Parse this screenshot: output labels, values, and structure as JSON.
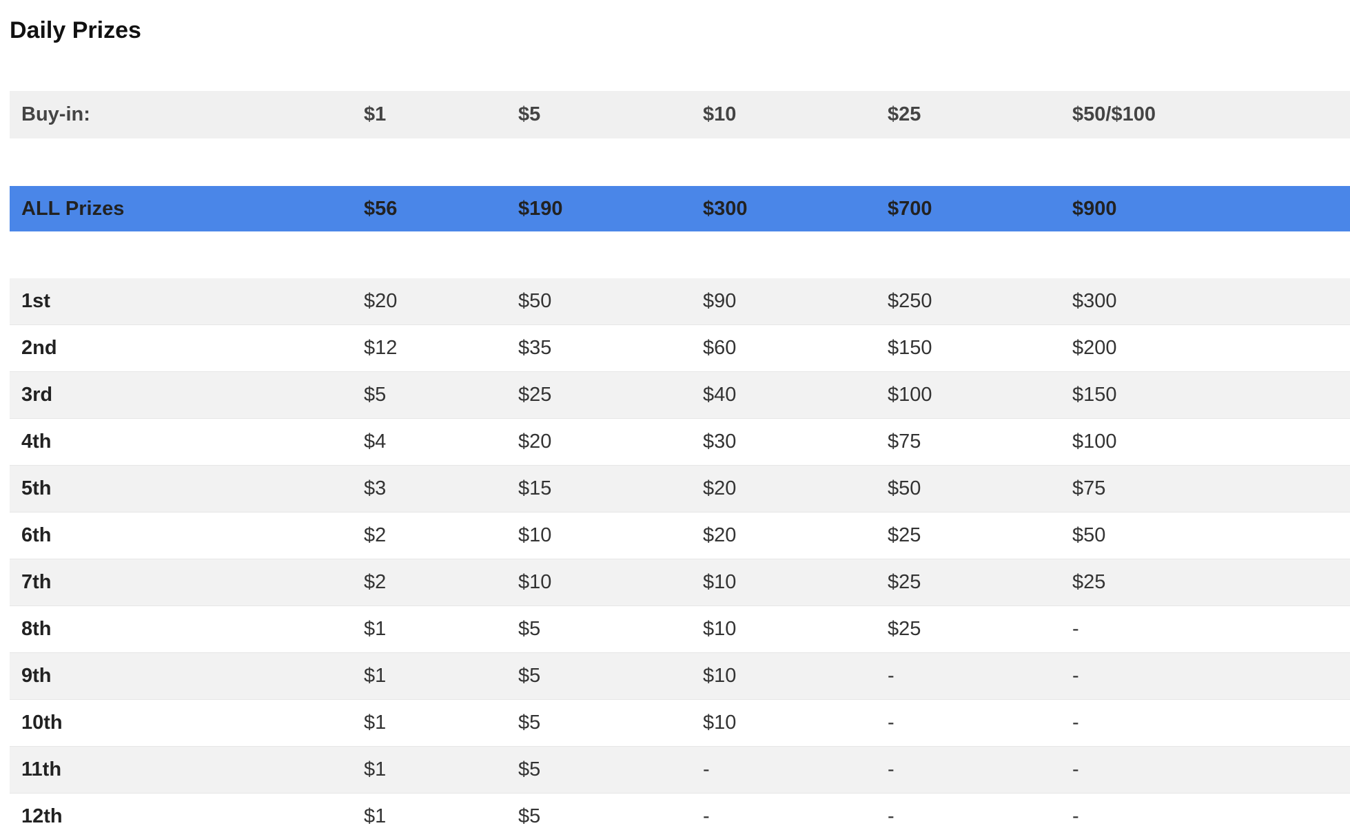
{
  "title": "Daily Prizes",
  "header": {
    "label": "Buy-in:",
    "values": [
      "$1",
      "$5",
      "$10",
      "$25",
      "$50/$100"
    ]
  },
  "total": {
    "label": "ALL Prizes",
    "values": [
      "$56",
      "$190",
      "$300",
      "$700",
      "$900"
    ],
    "color": "#4a86e8"
  },
  "rows": [
    {
      "place": "1st",
      "values": [
        "$20",
        "$50",
        "$90",
        "$250",
        "$300"
      ]
    },
    {
      "place": "2nd",
      "values": [
        "$12",
        "$35",
        "$60",
        "$150",
        "$200"
      ]
    },
    {
      "place": "3rd",
      "values": [
        "$5",
        "$25",
        "$40",
        "$100",
        "$150"
      ]
    },
    {
      "place": "4th",
      "values": [
        "$4",
        "$20",
        "$30",
        "$75",
        "$100"
      ]
    },
    {
      "place": "5th",
      "values": [
        "$3",
        "$15",
        "$20",
        "$50",
        "$75"
      ]
    },
    {
      "place": "6th",
      "values": [
        "$2",
        "$10",
        "$20",
        "$25",
        "$50"
      ]
    },
    {
      "place": "7th",
      "values": [
        "$2",
        "$10",
        "$10",
        "$25",
        "$25"
      ]
    },
    {
      "place": "8th",
      "values": [
        "$1",
        "$5",
        "$10",
        "$25",
        "-"
      ]
    },
    {
      "place": "9th",
      "values": [
        "$1",
        "$5",
        "$10",
        "-",
        "-"
      ]
    },
    {
      "place": "10th",
      "values": [
        "$1",
        "$5",
        "$10",
        "-",
        "-"
      ]
    },
    {
      "place": "11th",
      "values": [
        "$1",
        "$5",
        "-",
        "-",
        "-"
      ]
    },
    {
      "place": "12th",
      "values": [
        "$1",
        "$5",
        "-",
        "-",
        "-"
      ]
    }
  ]
}
